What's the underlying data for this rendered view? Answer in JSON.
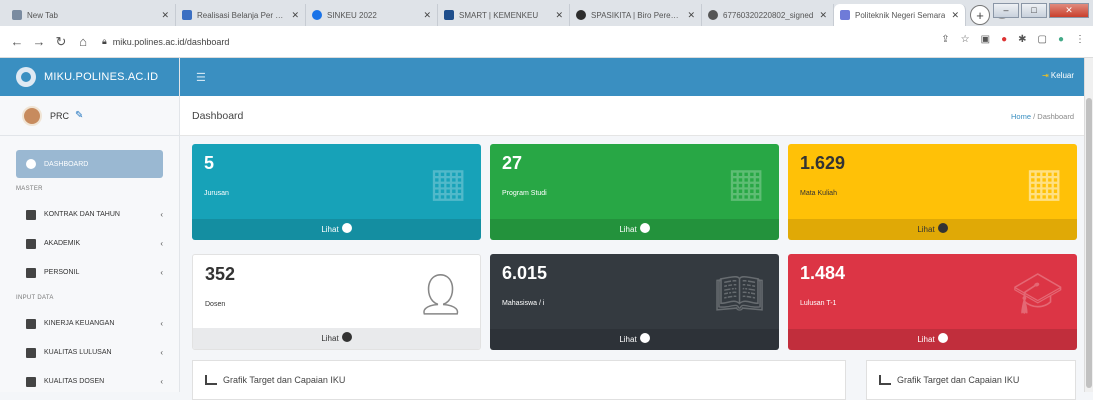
{
  "browser": {
    "tabs": [
      {
        "label": "New Tab",
        "color": "#7a8ba0"
      },
      {
        "label": "Realisasi Belanja Per Sum",
        "color": "#3b6fc2"
      },
      {
        "label": "SINKEU 2022",
        "color": "#1a73e8"
      },
      {
        "label": "SMART | KEMENKEU",
        "color": "#1e4e8c"
      },
      {
        "label": "SPASIKITA | Biro Perencan",
        "color": "#2d2d2d"
      },
      {
        "label": "67760320220802_signed",
        "color": "#555"
      },
      {
        "label": "Politeknik Negeri Semara",
        "color": "#6f7bd8"
      }
    ],
    "url": "miku.polines.ac.id/dashboard"
  },
  "sidebar": {
    "brand": "MIKU.POLINES.AC.ID",
    "user": "PRC",
    "items": [
      {
        "label": "DASHBOARD",
        "active": true
      },
      {
        "section": "MASTER"
      },
      {
        "label": "KONTRAK DAN TAHUN",
        "chevron": "‹"
      },
      {
        "label": "AKADEMIK",
        "chevron": "‹"
      },
      {
        "label": "PERSONIL",
        "chevron": "‹"
      },
      {
        "section": "INPUT DATA"
      },
      {
        "label": "KINERJA KEUANGAN",
        "chevron": "‹"
      },
      {
        "label": "KUALITAS LULUSAN",
        "chevron": "‹"
      },
      {
        "label": "KUALITAS DOSEN",
        "chevron": "‹"
      }
    ]
  },
  "topbar": {
    "logout": "Keluar"
  },
  "header": {
    "title": "Dashboard",
    "crumb_home": "Home",
    "crumb_sep": " / ",
    "crumb_current": "Dashboard"
  },
  "stats": [
    {
      "value": "5",
      "label": "Jurusan",
      "link": "Lihat"
    },
    {
      "value": "27",
      "label": "Program Studi",
      "link": "Lihat"
    },
    {
      "value": "1.629",
      "label": "Mata Kuliah",
      "link": "Lihat"
    },
    {
      "value": "352",
      "label": "Dosen",
      "link": "Lihat"
    },
    {
      "value": "6.015",
      "label": "Mahasiswa / i",
      "link": "Lihat"
    },
    {
      "value": "1.484",
      "label": "Lulusan T-1",
      "link": "Lihat"
    }
  ],
  "cards": {
    "left": "Grafik Target dan Capaian IKU",
    "right": "Grafik Target dan Capaian IKU"
  }
}
